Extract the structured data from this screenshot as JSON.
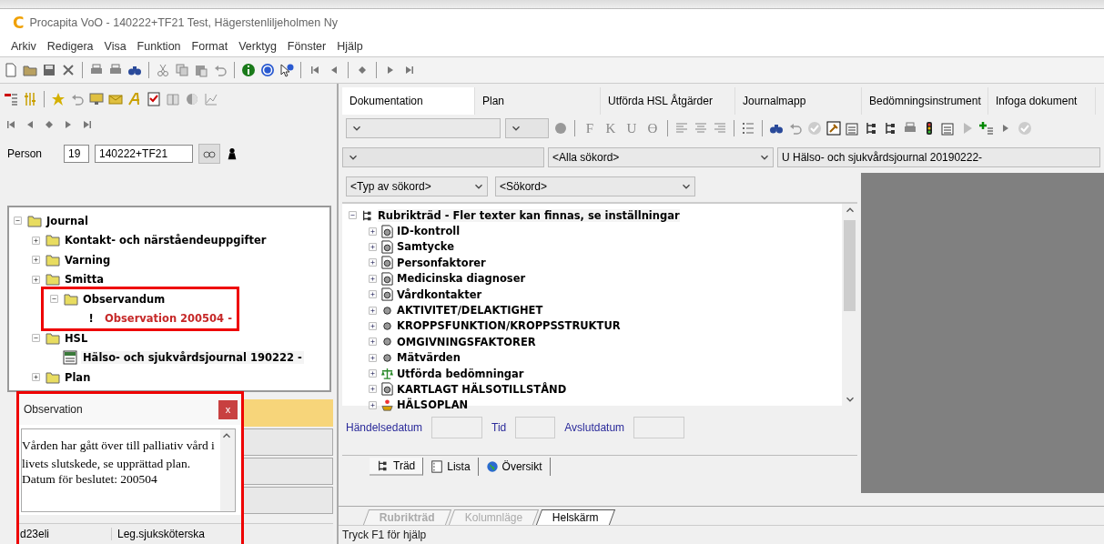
{
  "window": {
    "logo": "C",
    "title": "Procapita VoO - 140222+TF21 Test, Hägerstenliljeholmen Ny"
  },
  "menu": [
    "Arkiv",
    "Redigera",
    "Visa",
    "Funktion",
    "Format",
    "Verktyg",
    "Fönster",
    "Hjälp"
  ],
  "person": {
    "label": "Person",
    "century": "19",
    "id": "140222+TF21"
  },
  "journal_tree": [
    {
      "label": "Journal",
      "expanded": true,
      "children": [
        {
          "label": "Kontakt- och närståendeuppgifter",
          "expanded": false
        },
        {
          "label": "Varning",
          "expanded": false
        },
        {
          "label": "Smitta",
          "expanded": false
        },
        {
          "label": "Observandum",
          "expanded": true,
          "highlighted": true,
          "children": [
            {
              "kind": "alert",
              "mark": "!",
              "label": "Observation 200504 -",
              "selected": false
            }
          ]
        },
        {
          "label": "HSL",
          "expanded": true,
          "children": [
            {
              "kind": "document",
              "label": "Hälso- och sjukvårdsjournal 190222 -",
              "selected": true
            }
          ]
        },
        {
          "label": "Plan",
          "expanded": false
        }
      ]
    }
  ],
  "list_rows": [
    {
      "selected": true
    },
    {
      "selected": false
    },
    {
      "selected": false
    },
    {
      "selected": false
    }
  ],
  "popup": {
    "title": "Observation",
    "close": "x",
    "highlighted": true,
    "text": "Vården har gått över till palliativ vård i livets slutskede, se upprättad plan.",
    "date_line": "Datum för beslutet: 200504"
  },
  "footer": {
    "user": "d23eli",
    "role": "Leg.sjuksköterska"
  },
  "tabs": [
    {
      "label": "Dokumentation",
      "selected": true
    },
    {
      "label": "Plan",
      "selected": false
    },
    {
      "label": "Utförda HSL Åtgärder",
      "selected": false
    },
    {
      "label": "Journalmapp",
      "selected": false
    },
    {
      "label": "Bedömningsinstrument",
      "selected": false
    },
    {
      "label": "Infoga dokument",
      "selected": false
    }
  ],
  "format_letters": [
    "F",
    "K",
    "U",
    "Ө"
  ],
  "filters": {
    "keyword_filter": "<Alla sökord>",
    "document": "U Hälso- och sjukvårdsjournal 20190222-",
    "keyword_type": "<Typ av sökord>",
    "keyword": "<Sökord>"
  },
  "heading_tree": {
    "root": "Rubrikträd - Fler texter kan finnas, se inställningar",
    "items": [
      {
        "label": "ID-kontroll",
        "kind": "page"
      },
      {
        "label": "Samtycke",
        "kind": "page"
      },
      {
        "label": "Personfaktorer",
        "kind": "page"
      },
      {
        "label": "Medicinska diagnoser",
        "kind": "page"
      },
      {
        "label": "Vårdkontakter",
        "kind": "page"
      },
      {
        "label": "AKTIVITET/DELAKTIGHET",
        "kind": "dot"
      },
      {
        "label": "KROPPSFUNKTION/KROPPSSTRUKTUR",
        "kind": "dot"
      },
      {
        "label": "OMGIVNINGSFAKTORER",
        "kind": "dot"
      },
      {
        "label": "Mätvärden",
        "kind": "dot"
      },
      {
        "label": "Utförda bedömningar",
        "kind": "scale"
      },
      {
        "label": "KARTLAGT HÄLSOTILLSTÅND",
        "kind": "page"
      },
      {
        "label": "HÄLSOPLAN",
        "kind": "lamp"
      }
    ]
  },
  "date_fields": [
    "Händelsedatum",
    "Tid",
    "Avslutdatum"
  ],
  "view_tabs": [
    {
      "label": "Träd",
      "selected": true
    },
    {
      "label": "Lista",
      "selected": false
    },
    {
      "label": "Översikt",
      "selected": false
    }
  ],
  "sheet_tabs": [
    {
      "label": "Rubrikträd",
      "disabled": true
    },
    {
      "label": "Kolumnläge",
      "disabled": true
    },
    {
      "label": "Helskärm",
      "disabled": false
    }
  ],
  "status_bar": "Tryck F1 för hjälp"
}
